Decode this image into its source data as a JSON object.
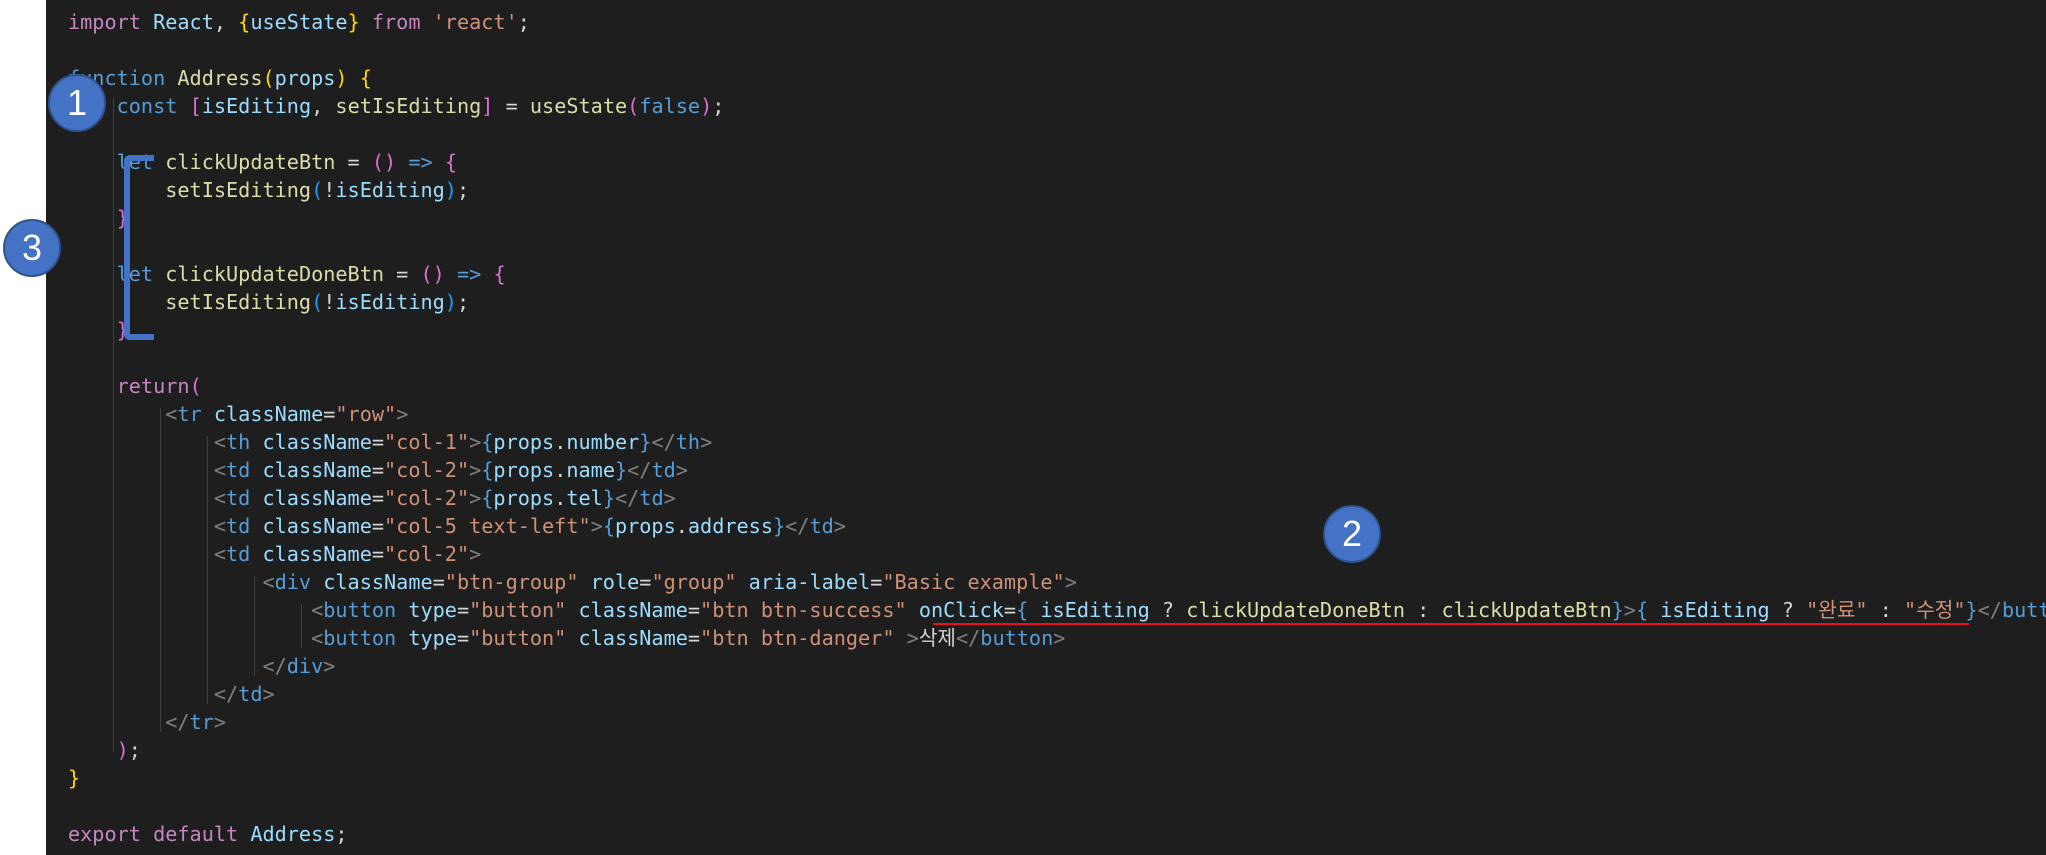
{
  "code_lines": [
    [
      [
        "import ",
        "t-ctl"
      ],
      [
        "React",
        "t-var"
      ],
      [
        ", ",
        "t-txt"
      ],
      [
        "{",
        "t-p1"
      ],
      [
        "useState",
        "t-var"
      ],
      [
        "}",
        "t-p1"
      ],
      [
        " from ",
        "t-ctl"
      ],
      [
        "'react'",
        "t-str"
      ],
      [
        ";",
        "t-txt"
      ]
    ],
    [],
    [
      [
        "function ",
        "t-kw"
      ],
      [
        "Address",
        "t-fn"
      ],
      [
        "(",
        "t-p1"
      ],
      [
        "props",
        "t-var"
      ],
      [
        ")",
        "t-p1"
      ],
      [
        " ",
        "t-txt"
      ],
      [
        "{",
        "t-p1"
      ]
    ],
    [
      [
        "    ",
        "t-txt"
      ],
      [
        "const ",
        "t-kw"
      ],
      [
        "[",
        "t-p2"
      ],
      [
        "isEditing",
        "t-var"
      ],
      [
        ", ",
        "t-txt"
      ],
      [
        "setIsEditing",
        "t-fn"
      ],
      [
        "]",
        "t-p2"
      ],
      [
        " = ",
        "t-txt"
      ],
      [
        "useState",
        "t-fn"
      ],
      [
        "(",
        "t-p2"
      ],
      [
        "false",
        "t-kw"
      ],
      [
        ")",
        "t-p2"
      ],
      [
        ";",
        "t-txt"
      ]
    ],
    [],
    [
      [
        "    ",
        "t-txt"
      ],
      [
        "let ",
        "t-kw"
      ],
      [
        "clickUpdateBtn",
        "t-fn"
      ],
      [
        " = ",
        "t-txt"
      ],
      [
        "()",
        "t-p2"
      ],
      [
        " => ",
        "t-kw"
      ],
      [
        "{",
        "t-p2"
      ]
    ],
    [
      [
        "        ",
        "t-txt"
      ],
      [
        "setIsEditing",
        "t-fn"
      ],
      [
        "(",
        "t-p3"
      ],
      [
        "!",
        "t-txt"
      ],
      [
        "isEditing",
        "t-var"
      ],
      [
        ")",
        "t-p3"
      ],
      [
        ";",
        "t-txt"
      ]
    ],
    [
      [
        "    ",
        "t-txt"
      ],
      [
        "}",
        "t-p2"
      ]
    ],
    [],
    [
      [
        "    ",
        "t-txt"
      ],
      [
        "let ",
        "t-kw"
      ],
      [
        "clickUpdateDoneBtn",
        "t-fn"
      ],
      [
        " = ",
        "t-txt"
      ],
      [
        "()",
        "t-p2"
      ],
      [
        " => ",
        "t-kw"
      ],
      [
        "{",
        "t-p2"
      ]
    ],
    [
      [
        "        ",
        "t-txt"
      ],
      [
        "setIsEditing",
        "t-fn"
      ],
      [
        "(",
        "t-p3"
      ],
      [
        "!",
        "t-txt"
      ],
      [
        "isEditing",
        "t-var"
      ],
      [
        ")",
        "t-p3"
      ],
      [
        ";",
        "t-txt"
      ]
    ],
    [
      [
        "    ",
        "t-txt"
      ],
      [
        "}",
        "t-p2"
      ]
    ],
    [],
    [
      [
        "    ",
        "t-txt"
      ],
      [
        "return",
        "t-ctl"
      ],
      [
        "(",
        "t-p2"
      ]
    ],
    [
      [
        "        ",
        "t-txt"
      ],
      [
        "<",
        "t-ang"
      ],
      [
        "tr",
        "t-tag"
      ],
      [
        " ",
        "t-txt"
      ],
      [
        "className",
        "t-var"
      ],
      [
        "=",
        "t-txt"
      ],
      [
        "\"row\"",
        "t-str"
      ],
      [
        ">",
        "t-ang"
      ]
    ],
    [
      [
        "            ",
        "t-txt"
      ],
      [
        "<",
        "t-ang"
      ],
      [
        "th",
        "t-tag"
      ],
      [
        " ",
        "t-txt"
      ],
      [
        "className",
        "t-var"
      ],
      [
        "=",
        "t-txt"
      ],
      [
        "\"col-1\"",
        "t-str"
      ],
      [
        ">",
        "t-ang"
      ],
      [
        "{",
        "t-kw"
      ],
      [
        "props",
        "t-var"
      ],
      [
        ".",
        "t-txt"
      ],
      [
        "number",
        "t-var"
      ],
      [
        "}",
        "t-kw"
      ],
      [
        "</",
        "t-ang"
      ],
      [
        "th",
        "t-tag"
      ],
      [
        ">",
        "t-ang"
      ]
    ],
    [
      [
        "            ",
        "t-txt"
      ],
      [
        "<",
        "t-ang"
      ],
      [
        "td",
        "t-tag"
      ],
      [
        " ",
        "t-txt"
      ],
      [
        "className",
        "t-var"
      ],
      [
        "=",
        "t-txt"
      ],
      [
        "\"col-2\"",
        "t-str"
      ],
      [
        ">",
        "t-ang"
      ],
      [
        "{",
        "t-kw"
      ],
      [
        "props",
        "t-var"
      ],
      [
        ".",
        "t-txt"
      ],
      [
        "name",
        "t-var"
      ],
      [
        "}",
        "t-kw"
      ],
      [
        "</",
        "t-ang"
      ],
      [
        "td",
        "t-tag"
      ],
      [
        ">",
        "t-ang"
      ]
    ],
    [
      [
        "            ",
        "t-txt"
      ],
      [
        "<",
        "t-ang"
      ],
      [
        "td",
        "t-tag"
      ],
      [
        " ",
        "t-txt"
      ],
      [
        "className",
        "t-var"
      ],
      [
        "=",
        "t-txt"
      ],
      [
        "\"col-2\"",
        "t-str"
      ],
      [
        ">",
        "t-ang"
      ],
      [
        "{",
        "t-kw"
      ],
      [
        "props",
        "t-var"
      ],
      [
        ".",
        "t-txt"
      ],
      [
        "tel",
        "t-var"
      ],
      [
        "}",
        "t-kw"
      ],
      [
        "</",
        "t-ang"
      ],
      [
        "td",
        "t-tag"
      ],
      [
        ">",
        "t-ang"
      ]
    ],
    [
      [
        "            ",
        "t-txt"
      ],
      [
        "<",
        "t-ang"
      ],
      [
        "td",
        "t-tag"
      ],
      [
        " ",
        "t-txt"
      ],
      [
        "className",
        "t-var"
      ],
      [
        "=",
        "t-txt"
      ],
      [
        "\"col-5 text-left\"",
        "t-str"
      ],
      [
        ">",
        "t-ang"
      ],
      [
        "{",
        "t-kw"
      ],
      [
        "props",
        "t-var"
      ],
      [
        ".",
        "t-txt"
      ],
      [
        "address",
        "t-var"
      ],
      [
        "}",
        "t-kw"
      ],
      [
        "</",
        "t-ang"
      ],
      [
        "td",
        "t-tag"
      ],
      [
        ">",
        "t-ang"
      ]
    ],
    [
      [
        "            ",
        "t-txt"
      ],
      [
        "<",
        "t-ang"
      ],
      [
        "td",
        "t-tag"
      ],
      [
        " ",
        "t-txt"
      ],
      [
        "className",
        "t-var"
      ],
      [
        "=",
        "t-txt"
      ],
      [
        "\"col-2\"",
        "t-str"
      ],
      [
        ">",
        "t-ang"
      ]
    ],
    [
      [
        "                ",
        "t-txt"
      ],
      [
        "<",
        "t-ang"
      ],
      [
        "div",
        "t-tag"
      ],
      [
        " ",
        "t-txt"
      ],
      [
        "className",
        "t-var"
      ],
      [
        "=",
        "t-txt"
      ],
      [
        "\"btn-group\"",
        "t-str"
      ],
      [
        " ",
        "t-txt"
      ],
      [
        "role",
        "t-var"
      ],
      [
        "=",
        "t-txt"
      ],
      [
        "\"group\"",
        "t-str"
      ],
      [
        " ",
        "t-txt"
      ],
      [
        "aria-label",
        "t-var"
      ],
      [
        "=",
        "t-txt"
      ],
      [
        "\"Basic example\"",
        "t-str"
      ],
      [
        ">",
        "t-ang"
      ]
    ],
    [
      [
        "                    ",
        "t-txt"
      ],
      [
        "<",
        "t-ang"
      ],
      [
        "button",
        "t-tag"
      ],
      [
        " ",
        "t-txt"
      ],
      [
        "type",
        "t-var"
      ],
      [
        "=",
        "t-txt"
      ],
      [
        "\"button\"",
        "t-str"
      ],
      [
        " ",
        "t-txt"
      ],
      [
        "className",
        "t-var"
      ],
      [
        "=",
        "t-txt"
      ],
      [
        "\"btn btn-success\"",
        "t-str"
      ],
      [
        " ",
        "t-txt"
      ],
      [
        "onClick",
        "t-var"
      ],
      [
        "=",
        "t-txt"
      ],
      [
        "{",
        "t-kw"
      ],
      [
        " ",
        "t-txt"
      ],
      [
        "isEditing",
        "t-var"
      ],
      [
        " ? ",
        "t-txt"
      ],
      [
        "clickUpdateDoneBtn",
        "t-fn"
      ],
      [
        " : ",
        "t-txt"
      ],
      [
        "clickUpdateBtn",
        "t-fn"
      ],
      [
        "}",
        "t-kw"
      ],
      [
        ">",
        "t-ang"
      ],
      [
        "{",
        "t-kw"
      ],
      [
        " ",
        "t-txt"
      ],
      [
        "isEditing",
        "t-var"
      ],
      [
        " ? ",
        "t-txt"
      ],
      [
        "\"완료\"",
        "t-str"
      ],
      [
        " : ",
        "t-txt"
      ],
      [
        "\"수정\"",
        "t-str"
      ],
      [
        "}",
        "t-kw"
      ],
      [
        "</",
        "t-ang"
      ],
      [
        "button",
        "t-tag"
      ],
      [
        ">",
        "t-ang"
      ]
    ],
    [
      [
        "                    ",
        "t-txt"
      ],
      [
        "<",
        "t-ang"
      ],
      [
        "button",
        "t-tag"
      ],
      [
        " ",
        "t-txt"
      ],
      [
        "type",
        "t-var"
      ],
      [
        "=",
        "t-txt"
      ],
      [
        "\"button\"",
        "t-str"
      ],
      [
        " ",
        "t-txt"
      ],
      [
        "className",
        "t-var"
      ],
      [
        "=",
        "t-txt"
      ],
      [
        "\"btn btn-danger\"",
        "t-str"
      ],
      [
        " ",
        "t-txt"
      ],
      [
        ">",
        "t-ang"
      ],
      [
        "삭제",
        "t-txt"
      ],
      [
        "</",
        "t-ang"
      ],
      [
        "button",
        "t-tag"
      ],
      [
        ">",
        "t-ang"
      ]
    ],
    [
      [
        "                ",
        "t-txt"
      ],
      [
        "</",
        "t-ang"
      ],
      [
        "div",
        "t-tag"
      ],
      [
        ">",
        "t-ang"
      ]
    ],
    [
      [
        "            ",
        "t-txt"
      ],
      [
        "</",
        "t-ang"
      ],
      [
        "td",
        "t-tag"
      ],
      [
        ">",
        "t-ang"
      ]
    ],
    [
      [
        "        ",
        "t-txt"
      ],
      [
        "</",
        "t-ang"
      ],
      [
        "tr",
        "t-tag"
      ],
      [
        ">",
        "t-ang"
      ]
    ],
    [
      [
        "    ",
        "t-txt"
      ],
      [
        ")",
        "t-p2"
      ],
      [
        ";",
        "t-txt"
      ]
    ],
    [
      [
        "}",
        "t-p1"
      ]
    ],
    [],
    [
      [
        "export ",
        "t-ctl"
      ],
      [
        "default ",
        "t-ctl"
      ],
      [
        "Address",
        "t-var"
      ],
      [
        ";",
        "t-txt"
      ]
    ]
  ],
  "annotations": {
    "badge_1": "1",
    "badge_2": "2",
    "badge_3": "3"
  },
  "colors": {
    "editor_background": "#1e1e1e",
    "annotation_blue": "#4472c4",
    "underline_red": "#e81123"
  }
}
